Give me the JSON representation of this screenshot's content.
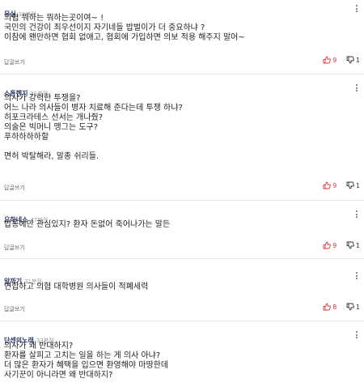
{
  "reply_label": "답글쓰기",
  "colors": {
    "nickname": "#2d3c6b",
    "upvote": "#d23a3a",
    "downvote": "#333333"
  },
  "comments": [
    {
      "nickname": "무심",
      "time": "31분전",
      "lines": [
        "의협 뭐하는 뭐하는곳이여~ !",
        "국민의 건강이 최우선이지 자기네들 밥벌이가 더 중요하냐 ?",
        "이참에 왠만하면 협회 없애고,  협회에 가입하면 의보 적용 해주지 말어~"
      ],
      "up": "9",
      "down": "1"
    },
    {
      "nickname": "스톤헨지",
      "time": "31분전",
      "lines": [
        "의사가 강력한 투쟁을?",
        "어느 나라 의사들이 병자 치료해 준다는데 투쟁 하냐?",
        "히포크라테스 선서는 개나줬?",
        "의술은 빅머니 맹그는 도구?",
        "푸하하하하할",
        "",
        "면허 박탈해라, 말종 쉬리들."
      ],
      "up": "9",
      "down": "1"
    },
    {
      "nickname": "요하네스",
      "time": "47분전",
      "lines": [
        "밥통에만 관심있지? 환자 돈없어 죽어나가는 말든"
      ],
      "up": "9",
      "down": "1"
    },
    {
      "nickname": "알까기",
      "time": "31분전",
      "lines": [
        "연합하고 의협 대학병원 의사들이 적폐세력"
      ],
      "up": "8",
      "down": "1"
    },
    {
      "nickname": "단센의노래",
      "time": "33분전",
      "lines": [
        "의사가 왜 반대하지?",
        "환자를 살피고 고치는 일을 하는 게 의사 아냐?",
        "더 많은 환자가 혜택을 입으면 환영해야 마땅한데",
        "사기꾼이 아니라면 왜 반대하지?"
      ],
      "up": "",
      "down": ""
    }
  ]
}
